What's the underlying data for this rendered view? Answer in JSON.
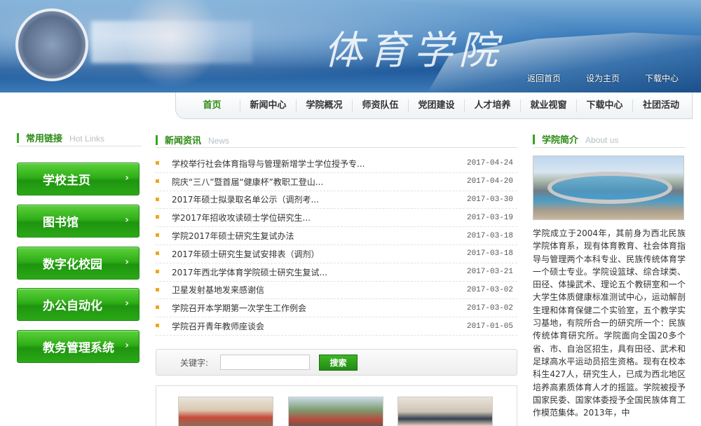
{
  "header": {
    "title": "体育学院",
    "links": [
      "返回首页",
      "设为主页",
      "下载中心"
    ]
  },
  "nav": {
    "items": [
      "首页",
      "新闻中心",
      "学院概况",
      "师资队伍",
      "党团建设",
      "人才培养",
      "就业视窗",
      "下载中心",
      "社团活动"
    ],
    "active": "首页"
  },
  "hot_links": {
    "title": "常用链接",
    "title_en": "Hot Links",
    "items": [
      "学校主页",
      "图书馆",
      "数字化校园",
      "办公自动化",
      "教务管理系统"
    ]
  },
  "news": {
    "title": "新闻资讯",
    "title_en": "News",
    "items": [
      {
        "title": "学校举行社会体育指导与管理新增学士学位授予专...",
        "date": "2017-04-24"
      },
      {
        "title": "院庆“三八”暨首届“健康杯”教职工登山...",
        "date": "2017-04-20"
      },
      {
        "title": "2017年硕士拟录取名单公示（调剂考...",
        "date": "2017-03-30"
      },
      {
        "title": "学2017年招收攻读硕士学位研究生...",
        "date": "2017-03-19"
      },
      {
        "title": "学院2017年硕士研究生复试办法",
        "date": "2017-03-18"
      },
      {
        "title": "2017年硕士研究生复试安排表（调剂）",
        "date": "2017-03-18"
      },
      {
        "title": "2017年西北学体育学院硕士研究生复试...",
        "date": "2017-03-21"
      },
      {
        "title": "卫星发射基地发来感谢信",
        "date": "2017-03-02"
      },
      {
        "title": "学院召开本学期第一次学生工作例会",
        "date": "2017-03-02"
      },
      {
        "title": "学院召开青年教师座谈会",
        "date": "2017-01-05"
      }
    ]
  },
  "search": {
    "label": "关键字:",
    "value": "",
    "button": "搜索"
  },
  "about": {
    "title": "学院简介",
    "title_en": "About us",
    "text": "学院成立于2004年，其前身为西北民族学院体育系，现有体育教育、社会体育指导与管理两个本科专业、民族传统体育学一个硕士专业。学院设篮球、综合球类、田径、体操武术、理论五个教研室和一个大学生体质健康标准测试中心，运动解剖生理和体育保健二个实验室，五个教学实习基地，有院所合一的研究所一个：民族传统体育研究所。学院面向全国20多个省、市、自治区招生，具有田径、武术和足球高水平运动员招生资格。现有在校本科生427人，研究生人，已成为西北地区培养高素质体育人才的摇篮。学院被授予国家民委、国家体委授予全国民族体育工作模范集体。2013年，中"
  }
}
